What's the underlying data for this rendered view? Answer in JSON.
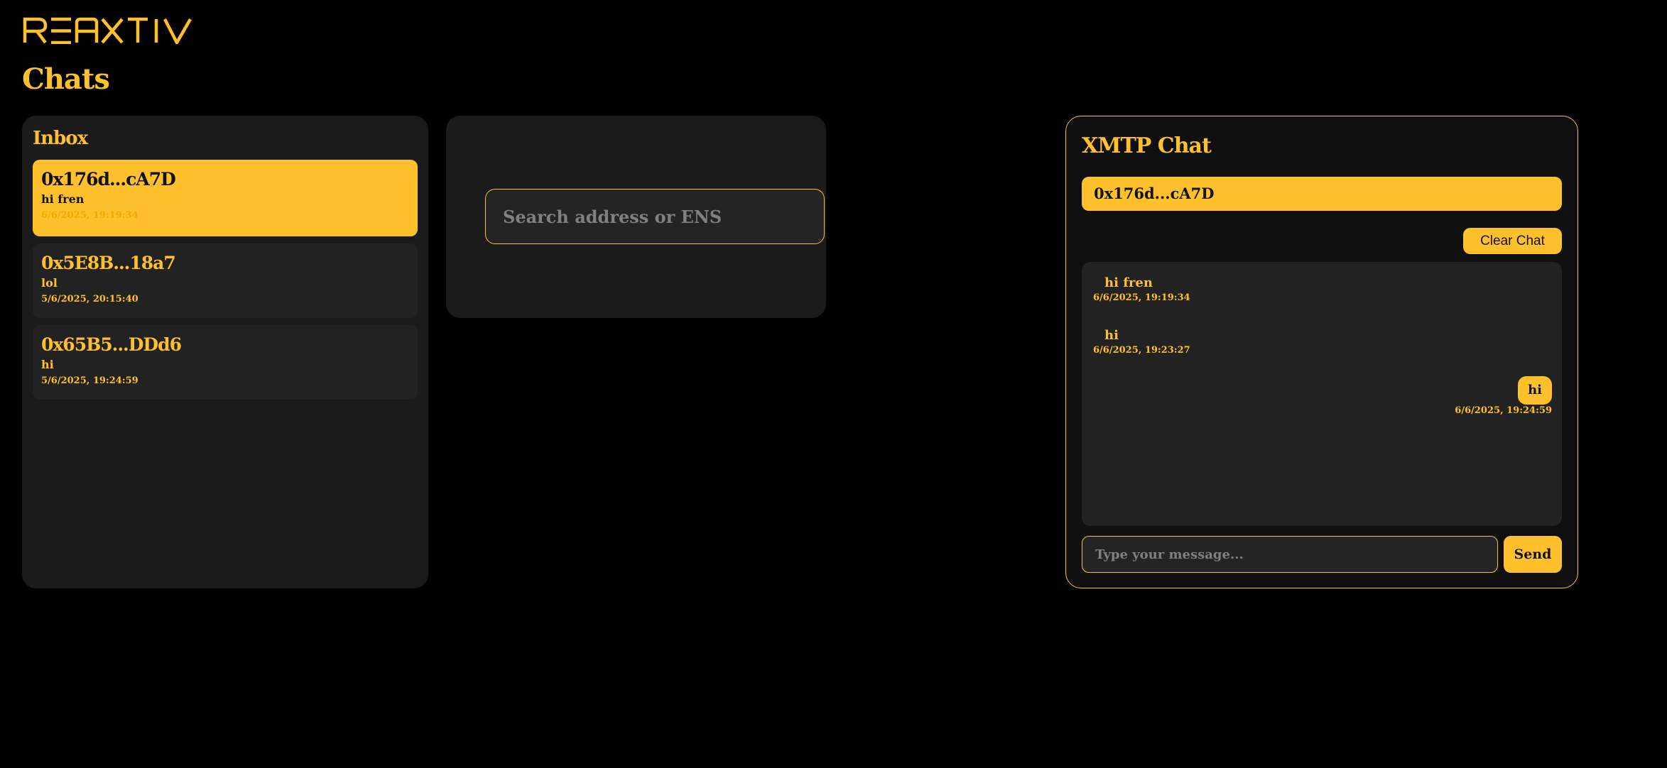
{
  "colors": {
    "background": "#000000",
    "panel": "#1B1B1B",
    "accent": "#FFC12B",
    "muted": "#808080",
    "dark_text": "#111111"
  },
  "brand": {
    "logo_text": "REAXTIV"
  },
  "page": {
    "title": "Chats"
  },
  "inbox": {
    "title": "Inbox",
    "conversations": [
      {
        "address": "0x176d...cA7D",
        "preview": "hi fren",
        "timestamp": "6/6/2025, 19:19:34",
        "active": true
      },
      {
        "address": "0x5E8B...18a7",
        "preview": "lol",
        "timestamp": "5/6/2025, 20:15:40",
        "active": false
      },
      {
        "address": "0x65B5...DDd6",
        "preview": "hi",
        "timestamp": "5/6/2025, 19:24:59",
        "active": false
      }
    ]
  },
  "search": {
    "placeholder": "Search address or ENS",
    "value": ""
  },
  "chat": {
    "title": "XMTP Chat",
    "recipient": "0x176d...cA7D",
    "clear_label": "Clear Chat",
    "messages": [
      {
        "direction": "in",
        "text": "hi fren",
        "timestamp": "6/6/2025, 19:19:34"
      },
      {
        "direction": "in",
        "text": "hi",
        "timestamp": "6/6/2025, 19:23:27"
      },
      {
        "direction": "out",
        "text": "hi",
        "timestamp": "6/6/2025, 19:24:59"
      }
    ],
    "compose_placeholder": "Type your message...",
    "compose_value": "",
    "send_label": "Send"
  }
}
